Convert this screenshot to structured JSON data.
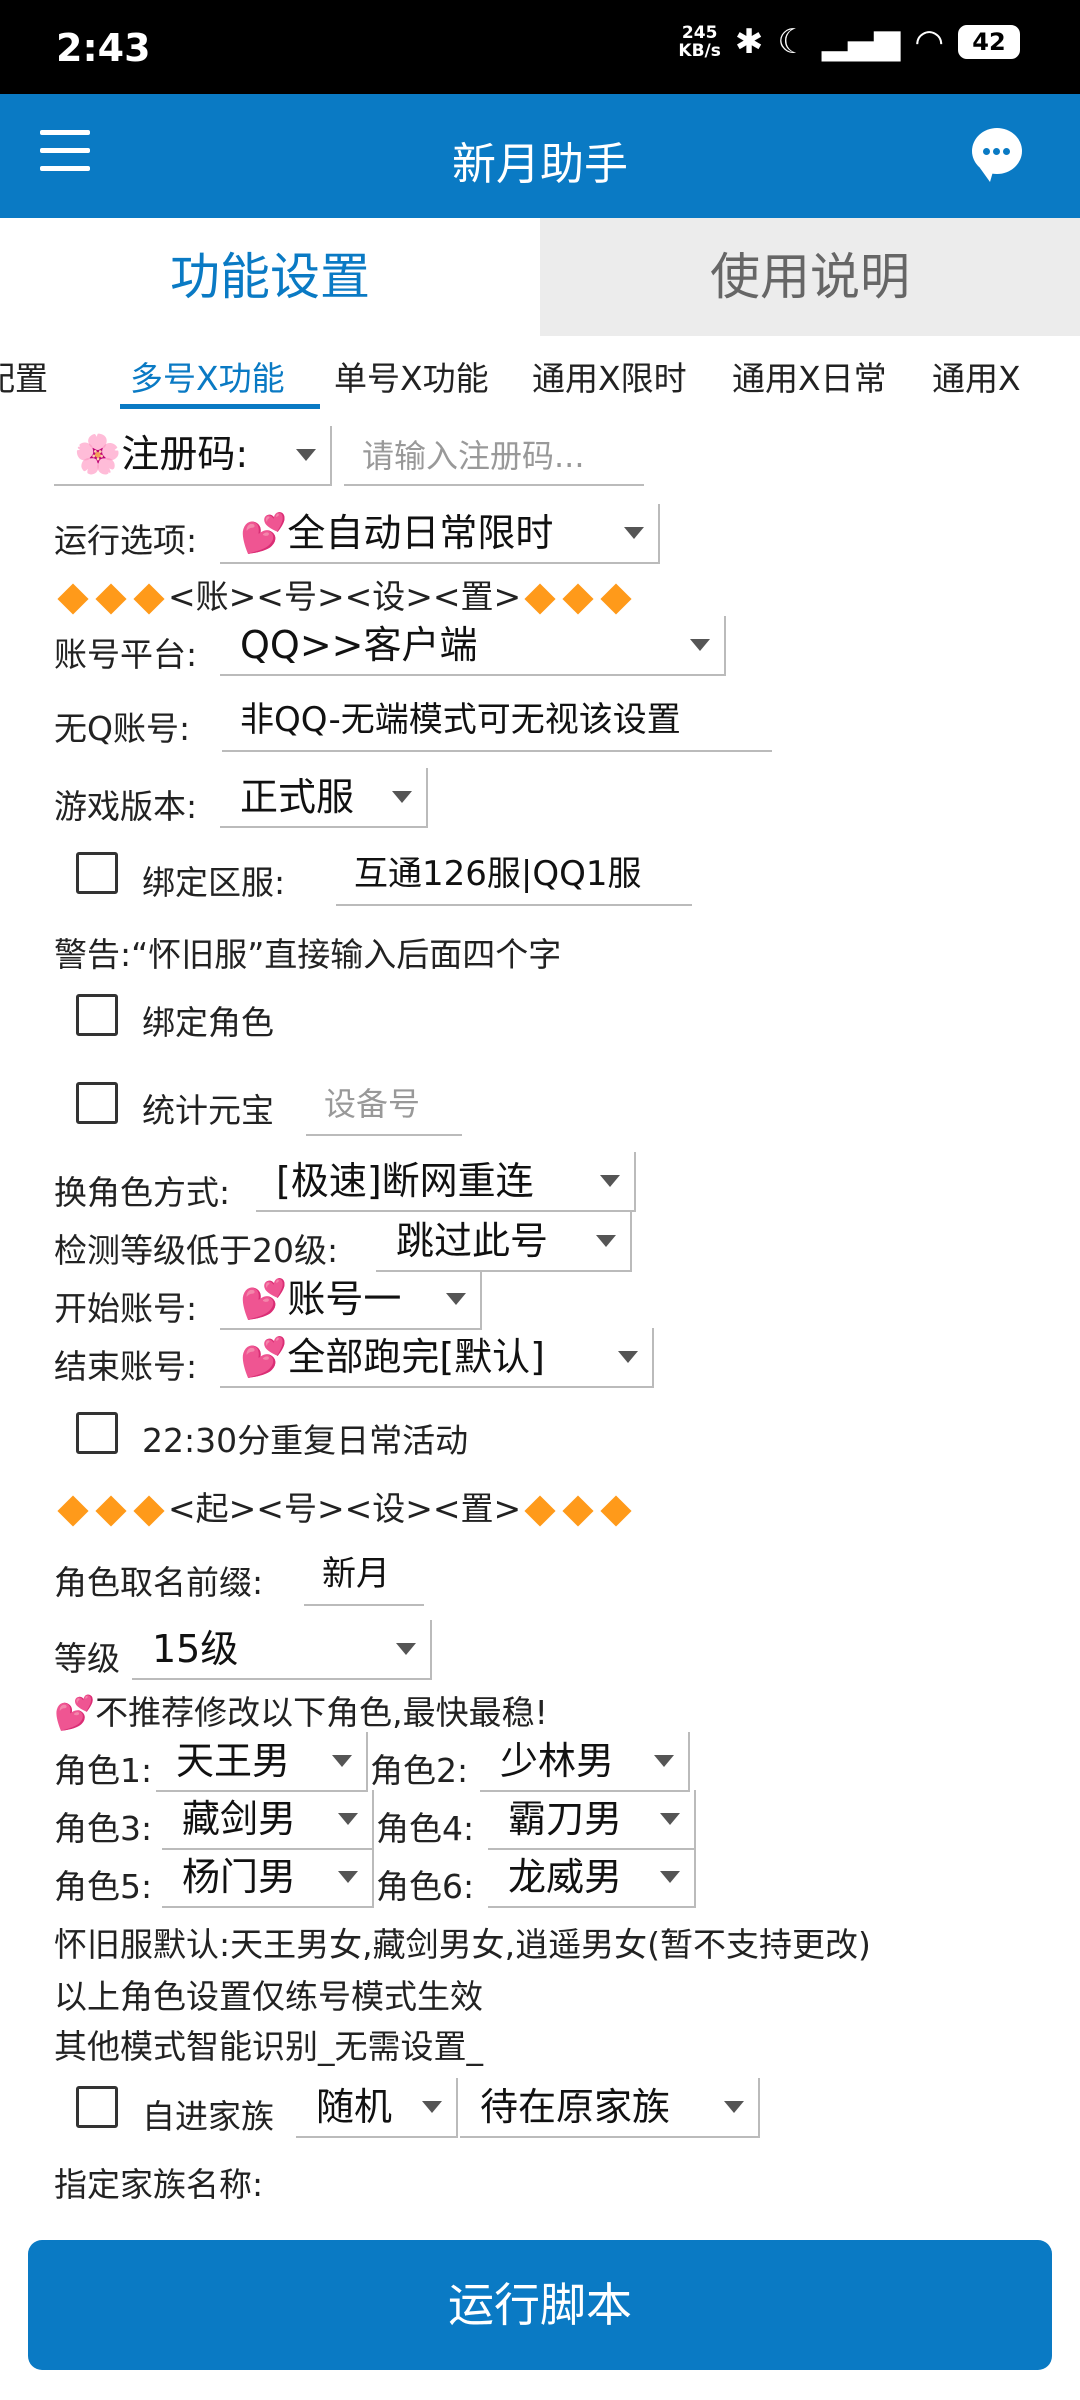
{
  "status": {
    "time": "2:43",
    "speed_top": "245",
    "speed_bottom": "KB/s",
    "battery": "42"
  },
  "appbar": {
    "title": "新月助手"
  },
  "main_tabs": [
    {
      "label": "功能设置"
    },
    {
      "label": "使用说明"
    }
  ],
  "sub_tabs": [
    {
      "label": "配置"
    },
    {
      "label": "多号X功能"
    },
    {
      "label": "单号X功能"
    },
    {
      "label": "通用X限时"
    },
    {
      "label": "通用X日常"
    },
    {
      "label": "通用X"
    }
  ],
  "form": {
    "reg_select": "🌸注册码:",
    "reg_placeholder": "请输入注册码...",
    "run_option_label": "运行选项:",
    "run_option_value": "💕全自动日常限时",
    "account_settings_header": "<账><号><设><置>",
    "platform_label": "账号平台:",
    "platform_value": "QQ>>客户端",
    "noq_label": "无Q账号:",
    "noq_value": "非QQ-无端模式可无视该设置",
    "version_label": "游戏版本:",
    "version_value": "正式服",
    "bind_server_label": "绑定区服:",
    "bind_server_value": "互通126服|QQ1服",
    "warning": "警告:“怀旧服”直接输入后面四个字",
    "bind_role_label": "绑定角色",
    "stat_ingot_label": "统计元宝",
    "device_placeholder": "设备号",
    "switch_role_label": "换角色方式:",
    "switch_role_value": "[极速]断网重连",
    "level_check_label": "检测等级低于20级:",
    "level_check_value": "跳过此号",
    "start_account_label": "开始账号:",
    "start_account_value": "💕账号一",
    "end_account_label": "结束账号:",
    "end_account_value": "💕全部跑完[默认]",
    "repeat_label": "22:30分重复日常活动",
    "naming_settings_header": "<起><号><设><置>",
    "prefix_label": "角色取名前缀:",
    "prefix_value": "新月",
    "level_label": "等级",
    "level_value": "15级",
    "recommend_note": "💕不推荐修改以下角色,最快最稳!",
    "roles": [
      {
        "label": "角色1:",
        "value": "天王男"
      },
      {
        "label": "角色2:",
        "value": "少林男"
      },
      {
        "label": "角色3:",
        "value": "藏剑男"
      },
      {
        "label": "角色4:",
        "value": "霸刀男"
      },
      {
        "label": "角色5:",
        "value": "杨门男"
      },
      {
        "label": "角色6:",
        "value": "龙威男"
      }
    ],
    "note1": "怀旧服默认:天王男女,藏剑男女,逍遥男女(暂不支持更改)",
    "note2": "以上角色设置仅练号模式生效",
    "note3": "其他模式智能识别_无需设置_",
    "family_label": "自进家族",
    "family_mode": "随机",
    "family_action": "待在原家族",
    "family_name_label": "指定家族名称:"
  },
  "run_button": "运行脚本",
  "colors": {
    "accent": "#0a7ac4",
    "diamond": "#ff9a1a"
  }
}
